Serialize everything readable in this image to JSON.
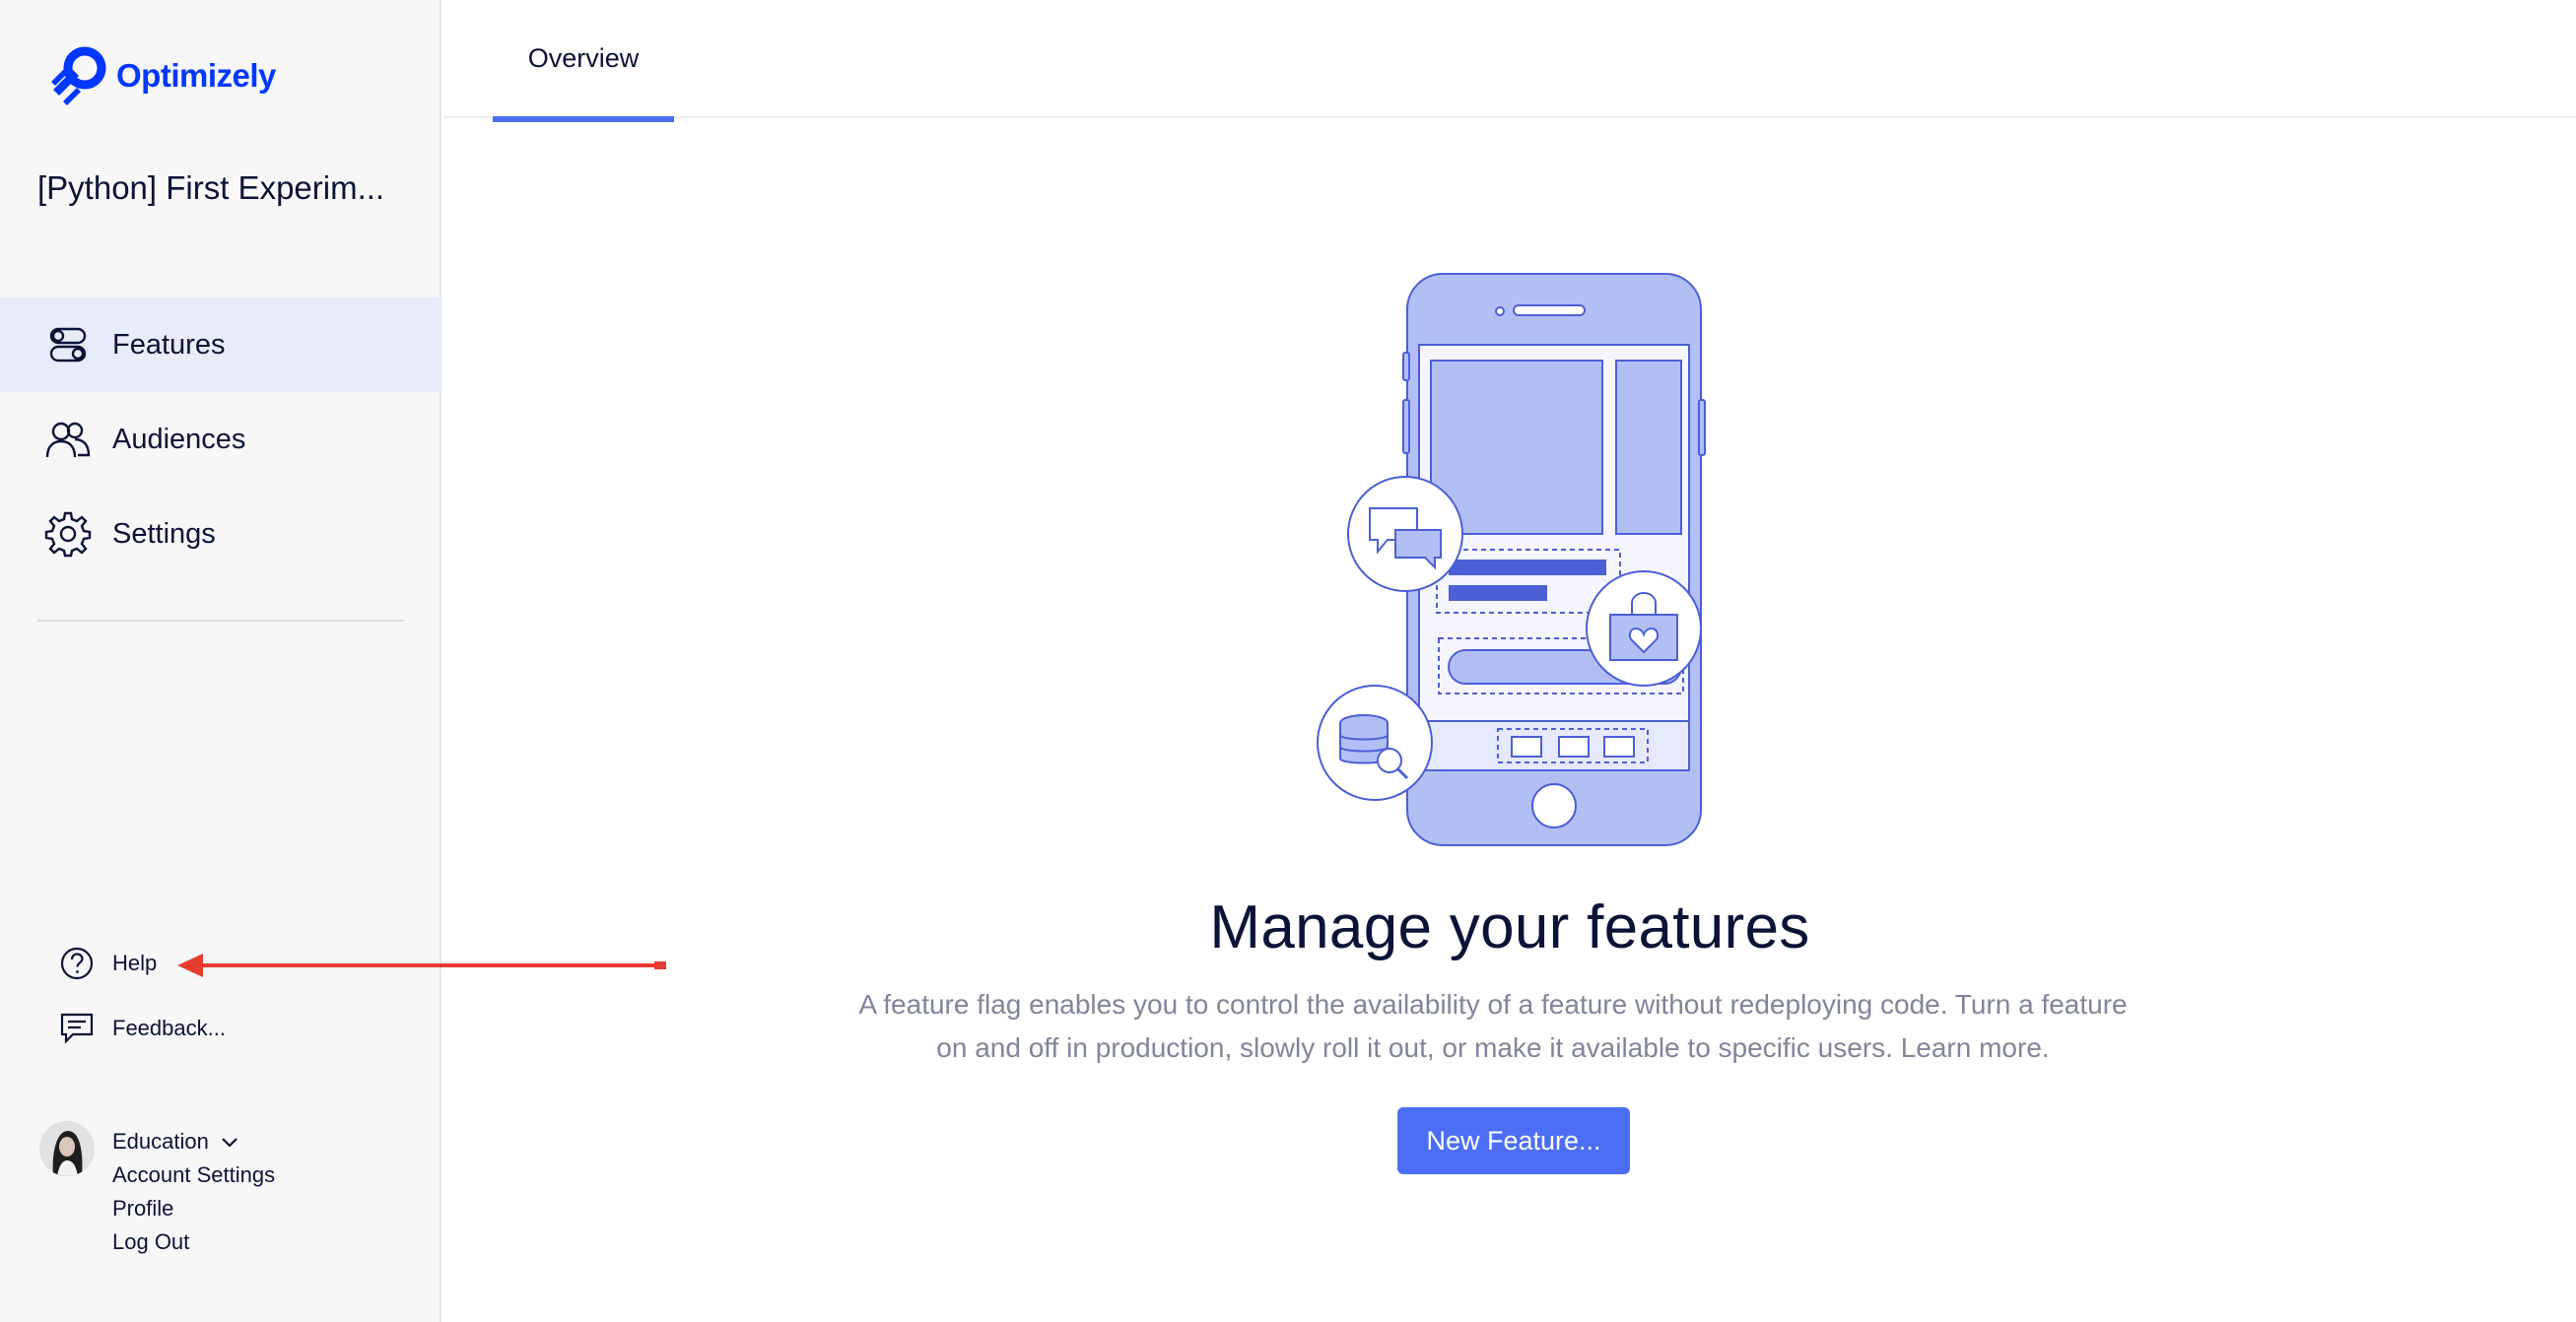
{
  "app": {
    "brand_name": "Optimizely",
    "brand_color": "#0037ff",
    "project_name": "[Python] First Experim..."
  },
  "sidebar": {
    "nav_items": [
      {
        "label": "Features",
        "icon": "toggle-icon",
        "active": true
      },
      {
        "label": "Audiences",
        "icon": "users-icon",
        "active": false
      },
      {
        "label": "Settings",
        "icon": "gear-icon",
        "active": false
      }
    ],
    "utility_items": [
      {
        "label": "Help",
        "icon": "question-circle-icon"
      },
      {
        "label": "Feedback...",
        "icon": "message-icon"
      }
    ],
    "account": {
      "org": "Education",
      "links": [
        "Account Settings",
        "Profile",
        "Log Out"
      ]
    }
  },
  "main": {
    "tabs": [
      {
        "label": "Overview",
        "active": true
      }
    ],
    "empty_state": {
      "headline": "Manage your features",
      "description": "A feature flag enables you to control the availability of a feature without redeploying code. Turn a feature on and off in production, slowly roll it out, or make it available to specific users. Learn more.",
      "button_label": "New Feature..."
    }
  },
  "colors": {
    "accent": "#4c6ef5",
    "active_nav_bg": "#e8ebf8",
    "illustration_fill": "#b1bff5",
    "illustration_stroke": "#4c5fd7",
    "annotation_arrow": "#e63b2e"
  }
}
